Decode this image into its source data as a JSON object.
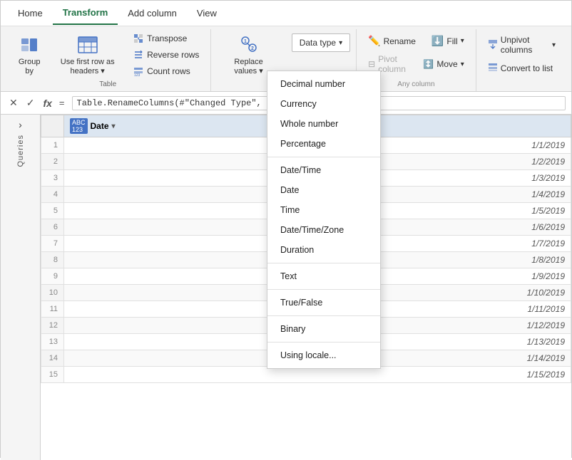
{
  "menu": {
    "items": [
      {
        "label": "Home",
        "active": false
      },
      {
        "label": "Transform",
        "active": true
      },
      {
        "label": "Add column",
        "active": false
      },
      {
        "label": "View",
        "active": false
      }
    ]
  },
  "ribbon": {
    "groups": [
      {
        "name": "table",
        "label": "Table",
        "buttons": [
          {
            "id": "group-by",
            "label": "Group\nby",
            "icon": "group-by-icon"
          },
          {
            "id": "first-row-headers",
            "label": "Use first row as\nheaders",
            "icon": "headers-icon",
            "hasDropdown": true
          }
        ],
        "small_buttons": [
          {
            "id": "transpose",
            "label": "Transpose",
            "icon": "transpose-icon"
          },
          {
            "id": "reverse-rows",
            "label": "Reverse rows",
            "icon": "reverse-rows-icon"
          },
          {
            "id": "count-rows",
            "label": "Count rows",
            "icon": "count-rows-icon"
          }
        ]
      }
    ],
    "replace_values": {
      "label": "Replace\nvalues",
      "icon": "replace-values-icon"
    },
    "data_type": {
      "label": "Data type",
      "hasDropdown": true,
      "dropdown_items": [
        {
          "label": "Decimal number",
          "divider_after": false
        },
        {
          "label": "Currency",
          "divider_after": false
        },
        {
          "label": "Whole number",
          "divider_after": false
        },
        {
          "label": "Percentage",
          "divider_after": true
        },
        {
          "label": "Date/Time",
          "divider_after": false
        },
        {
          "label": "Date",
          "divider_after": false
        },
        {
          "label": "Time",
          "divider_after": false
        },
        {
          "label": "Date/Time/Zone",
          "divider_after": false
        },
        {
          "label": "Duration",
          "divider_after": true
        },
        {
          "label": "Text",
          "divider_after": true
        },
        {
          "label": "True/False",
          "divider_after": true
        },
        {
          "label": "Binary",
          "divider_after": true
        },
        {
          "label": "Using locale...",
          "divider_after": false
        }
      ]
    },
    "rename_btn": "Rename",
    "fill_btn": "Fill",
    "pivot_column_btn": "Pivot column",
    "move_btn": "Move",
    "unpivot_columns_btn": "Unpivot columns",
    "convert_to_list_btn": "Convert to list",
    "any_column_label": "Any column",
    "group_label": "Table"
  },
  "formula_bar": {
    "formula": "= Table.RenameColumn",
    "full_formula": "= Table.RenameColumns(#\"Changed Type\", {{\"Column1\", \"Date\"}})"
  },
  "table": {
    "column_header": "Date",
    "column_type": "ABC\n123",
    "rows": [
      {
        "num": 1,
        "value": "1/1/2019"
      },
      {
        "num": 2,
        "value": "1/2/2019"
      },
      {
        "num": 3,
        "value": "1/3/2019"
      },
      {
        "num": 4,
        "value": "1/4/2019"
      },
      {
        "num": 5,
        "value": "1/5/2019"
      },
      {
        "num": 6,
        "value": "1/6/2019"
      },
      {
        "num": 7,
        "value": "1/7/2019"
      },
      {
        "num": 8,
        "value": "1/8/2019"
      },
      {
        "num": 9,
        "value": "1/9/2019"
      },
      {
        "num": 10,
        "value": "1/10/2019"
      },
      {
        "num": 11,
        "value": "1/11/2019"
      },
      {
        "num": 12,
        "value": "1/12/2019"
      },
      {
        "num": 13,
        "value": "1/13/2019"
      },
      {
        "num": 14,
        "value": "1/14/2019"
      },
      {
        "num": 15,
        "value": "1/15/2019"
      }
    ]
  },
  "sidebar": {
    "queries_label": "Queries",
    "expand_arrow": "›"
  }
}
